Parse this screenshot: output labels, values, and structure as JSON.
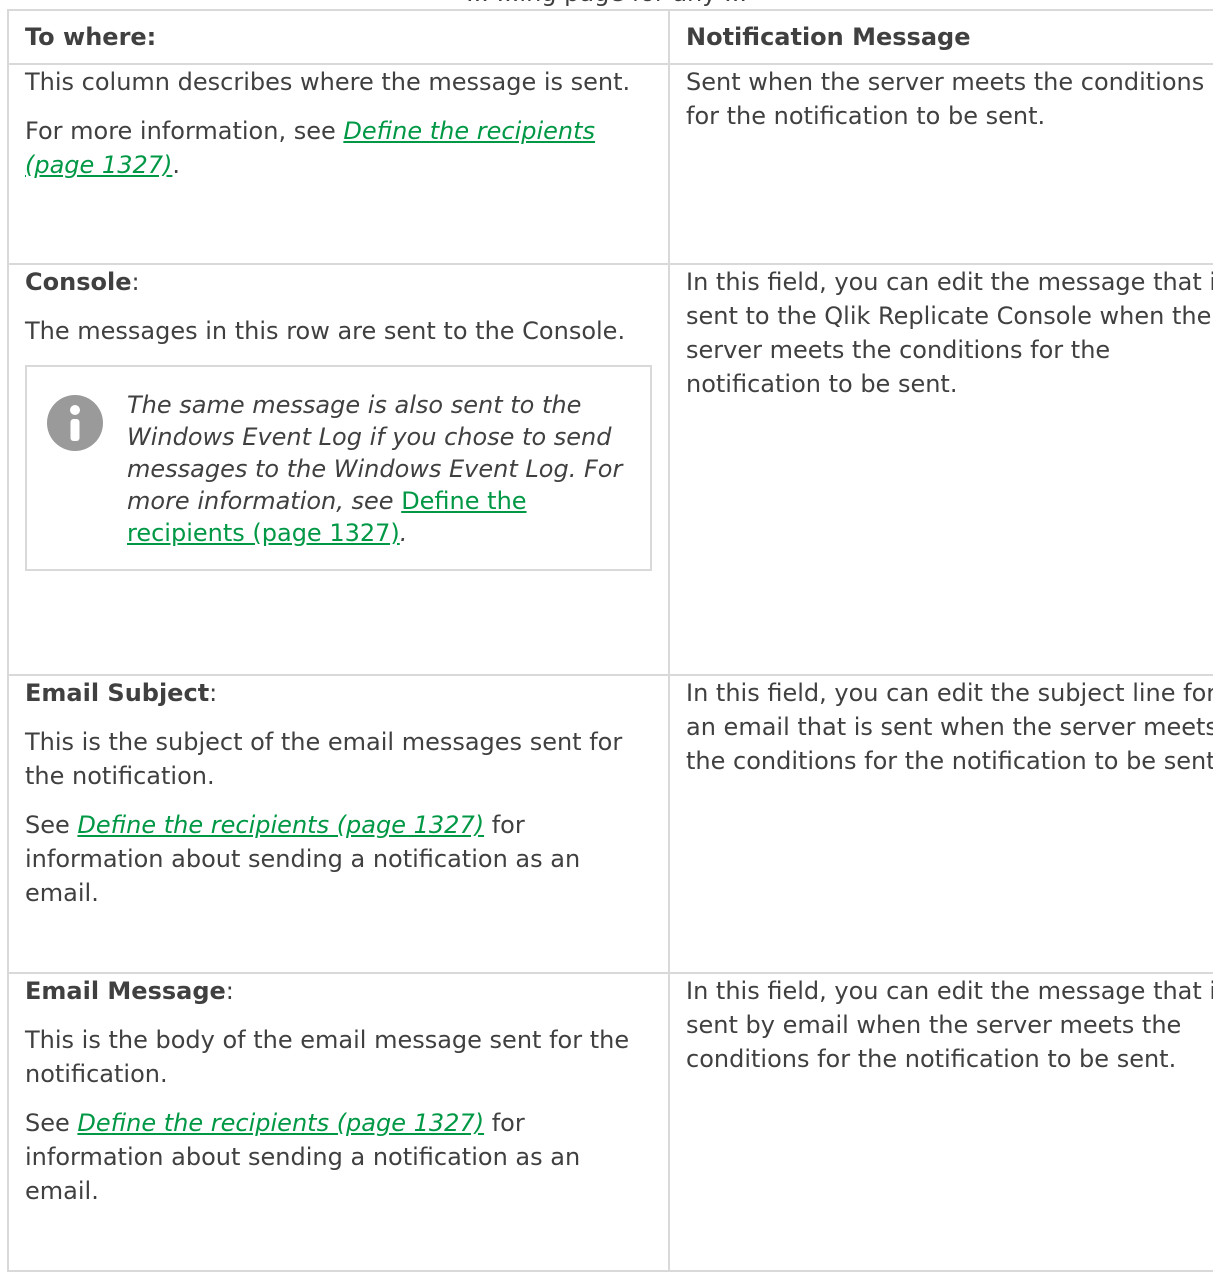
{
  "caption_fragment": "... ...ing page for any ...",
  "table": {
    "headers": [
      "To where:",
      "Notification Message"
    ],
    "rows": [
      {
        "left": {
          "para1": "This column describes where the message is sent.",
          "para2_prefix": "For more information, see ",
          "para2_link": "Define the recipients (page 1327)",
          "para2_suffix": "."
        },
        "right": "Sent when the server meets the conditions for the notification to be sent."
      },
      {
        "left": {
          "title": "Console",
          "title_suffix": ":",
          "para1": "The messages in this row are sent to the Console.",
          "note": {
            "icon": "info-icon",
            "text": "The same message is also sent to the Windows Event Log if you chose to send messages to the Windows Event Log. For more information, see ",
            "link": "Define the recipients (page 1327)",
            "suffix": "."
          }
        },
        "right": "In this field, you can edit the message that is sent to the Qlik Replicate Console when the server meets the conditions for the notification to be sent."
      },
      {
        "left": {
          "title": "Email Subject",
          "title_suffix": ":",
          "para1": "This is the subject of the email messages sent for the notification.",
          "para2_prefix": "See ",
          "para2_link": "Define the recipients (page 1327)",
          "para2_suffix": " for information about sending a notification as an email."
        },
        "right": "In this field, you can edit the subject line for an email that is sent when the server meets the conditions for the notification to be sent."
      },
      {
        "left": {
          "title": "Email Message",
          "title_suffix": ":",
          "para1": "This is the body of the email message sent for the notification.",
          "para2_prefix": "See ",
          "para2_link": "Define the recipients (page 1327)",
          "para2_suffix": " for information about sending a notification as an email."
        },
        "right": "In this field, you can edit the message that is sent by email when the server meets the conditions for the notification to be sent."
      }
    ]
  },
  "colors": {
    "text": "#404040",
    "link": "#009845",
    "border": "#d9d9d9",
    "icon": "#9a9a9a"
  }
}
